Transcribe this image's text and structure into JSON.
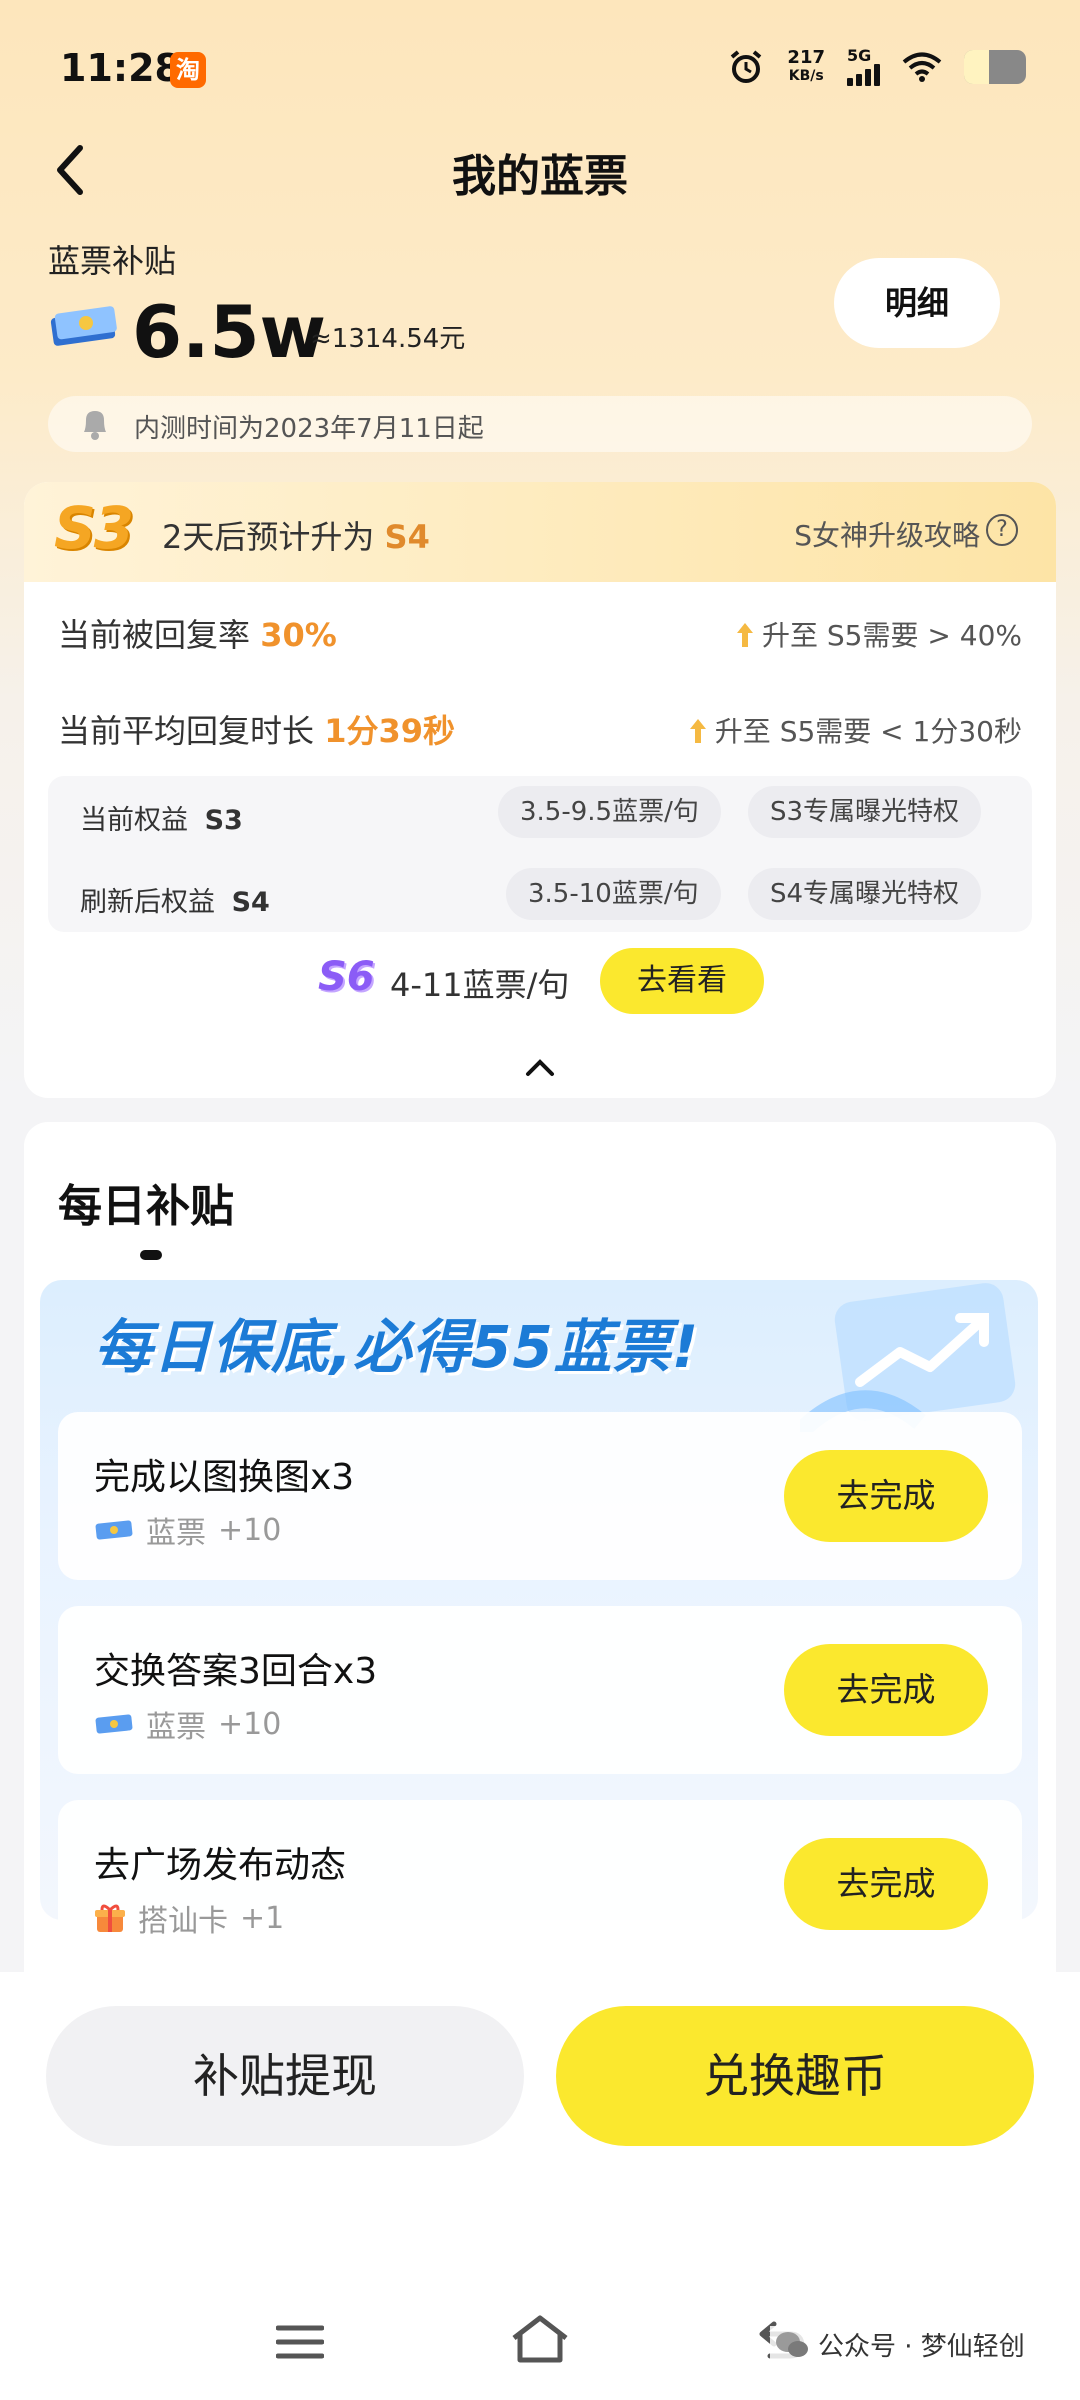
{
  "status_bar": {
    "time": "11:28",
    "app_badge": "淘",
    "net_speed_value": "217",
    "net_speed_unit": "KB/s",
    "network": "5G",
    "battery_level": 0.4
  },
  "header": {
    "title": "我的蓝票"
  },
  "subsidy": {
    "label": "蓝票补贴",
    "value": "6.5w",
    "approx": "≈1314.54元",
    "detail_button": "明细",
    "notice": "内测时间为2023年7月11日起"
  },
  "level": {
    "badge": "S3",
    "upgrade_prefix": "2天后预计升为",
    "upgrade_level": "S4",
    "strategy_link": "S女神升级攻略",
    "help_icon": "?",
    "metrics": [
      {
        "label": "当前被回复率",
        "value": "30%",
        "target": "升至 S5需要 > 40%"
      },
      {
        "label": "当前平均回复时长",
        "value": "1分39秒",
        "target": "升至 S5需要 < 1分30秒"
      }
    ],
    "rights": [
      {
        "label": "当前权益",
        "level": "S3",
        "price": "3.5-9.5蓝票/句",
        "privilege": "S3专属曝光特权"
      },
      {
        "label": "刷新后权益",
        "level": "S4",
        "price": "3.5-10蓝票/句",
        "privilege": "S4专属曝光特权"
      }
    ],
    "s6_badge": "S6",
    "s6_text": "4-11蓝票/句",
    "look_button": "去看看"
  },
  "daily": {
    "title": "每日补贴",
    "banner_title": "每日保底,必得55蓝票!",
    "tasks": [
      {
        "title": "完成以图换图x3",
        "reward_icon": "ticket-icon",
        "reward_name": "蓝票",
        "reward_amount": "+10",
        "button": "去完成"
      },
      {
        "title": "交换答案3回合x3",
        "reward_icon": "ticket-icon",
        "reward_name": "蓝票",
        "reward_amount": "+10",
        "button": "去完成"
      },
      {
        "title": "去广场发布动态",
        "reward_icon": "gift-icon",
        "reward_name": "搭讪卡",
        "reward_amount": "+1",
        "button": "去完成"
      }
    ]
  },
  "bottom": {
    "withdraw": "补贴提现",
    "exchange": "兑换趣币"
  },
  "footer": {
    "credit": "公众号 · 梦仙轻创"
  },
  "colors": {
    "accent_yellow": "#fbe82e",
    "level_orange": "#f0922c",
    "banner_blue": "#1c7bd6"
  }
}
